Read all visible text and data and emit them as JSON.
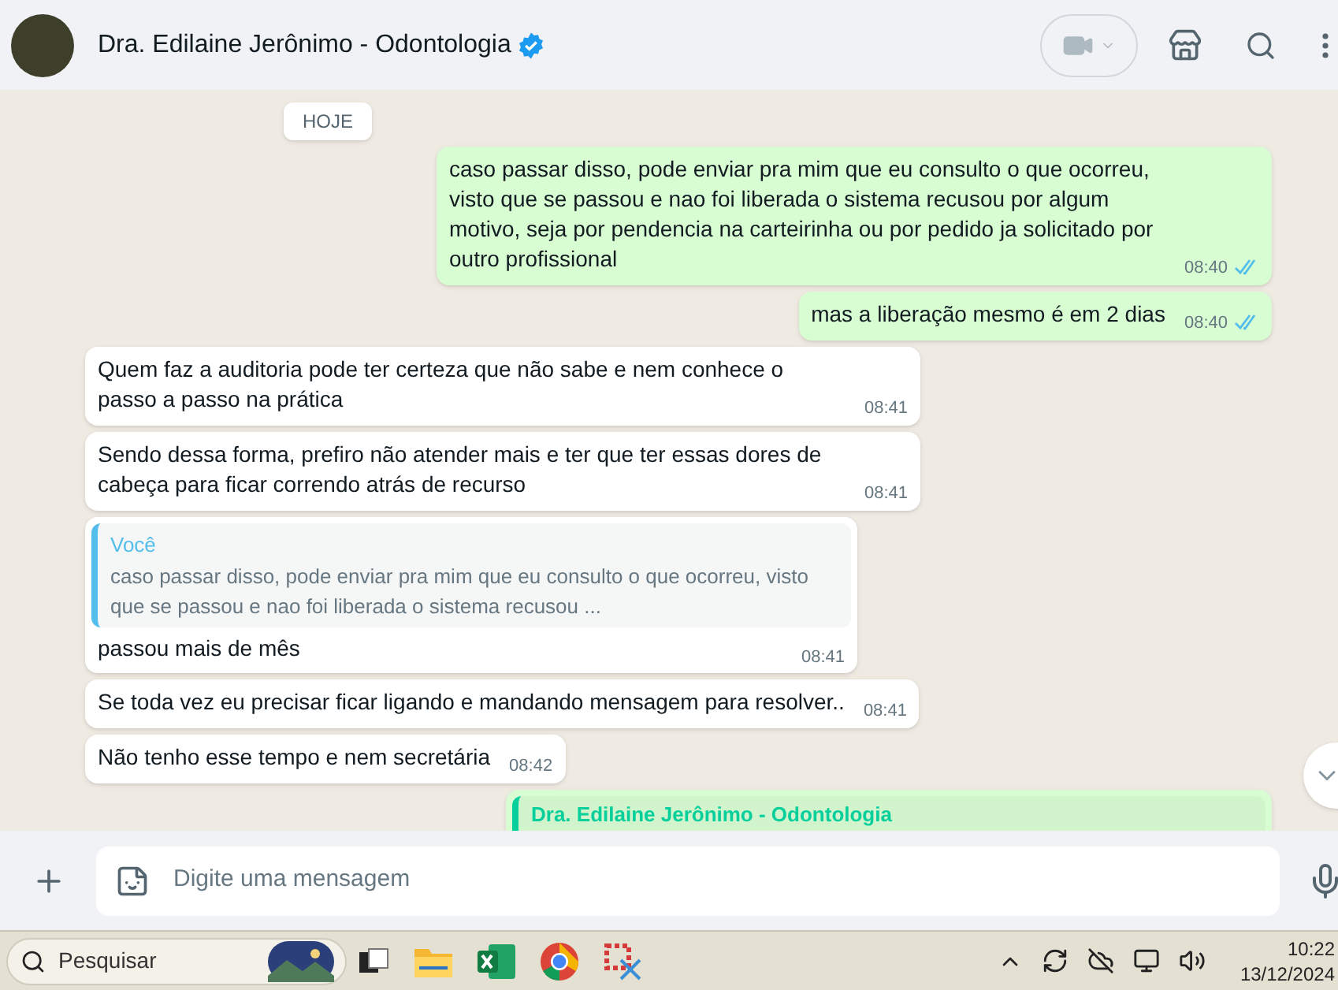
{
  "header": {
    "contact_name": "Dra. Edilaine Jerônimo - Odontologia",
    "verified": true
  },
  "date_chip": "HOJE",
  "messages": [
    {
      "outgoing": true,
      "kind": "text",
      "text": "caso passar disso, pode enviar pra mim que eu consulto o que ocorreu, visto que se passou e nao foi liberada o sistema recusou por algum motivo, seja por pendencia na carteirinha ou por pedido ja solicitado por outro profissional",
      "time": "08:40",
      "read": true
    },
    {
      "outgoing": true,
      "kind": "text",
      "text": "mas a liberação mesmo é em 2 dias",
      "time": "08:40",
      "read": true
    },
    {
      "outgoing": false,
      "kind": "text",
      "text": "Quem faz a auditoria pode ter certeza que não sabe e nem conhece o passo a passo na prática",
      "time": "08:41"
    },
    {
      "outgoing": false,
      "kind": "text",
      "text": "Sendo dessa forma, prefiro não atender mais e ter que ter essas dores de cabeça para ficar correndo atrás de recurso",
      "time": "08:41"
    },
    {
      "outgoing": false,
      "kind": "reply",
      "quote_author": "Você",
      "quote_text": "caso passar disso, pode enviar pra mim que eu consulto o que ocorreu, visto que se passou e nao foi liberada o sistema recusou ...",
      "text": "passou mais de mês",
      "time": "08:41"
    },
    {
      "outgoing": false,
      "kind": "text",
      "text": "Se toda vez eu precisar ficar ligando e mandando mensagem para resolver..",
      "time": "08:41"
    },
    {
      "outgoing": false,
      "kind": "text",
      "text": "Não tenho esse tempo e nem secretária",
      "time": "08:42"
    },
    {
      "outgoing": true,
      "kind": "partial",
      "quote_author": "Dra. Edilaine Jerônimo - Odontologia"
    }
  ],
  "composer": {
    "placeholder": "Digite uma mensagem"
  },
  "taskbar": {
    "search_placeholder": "Pesquisar",
    "time": "10:22",
    "date": "13/12/2024"
  }
}
